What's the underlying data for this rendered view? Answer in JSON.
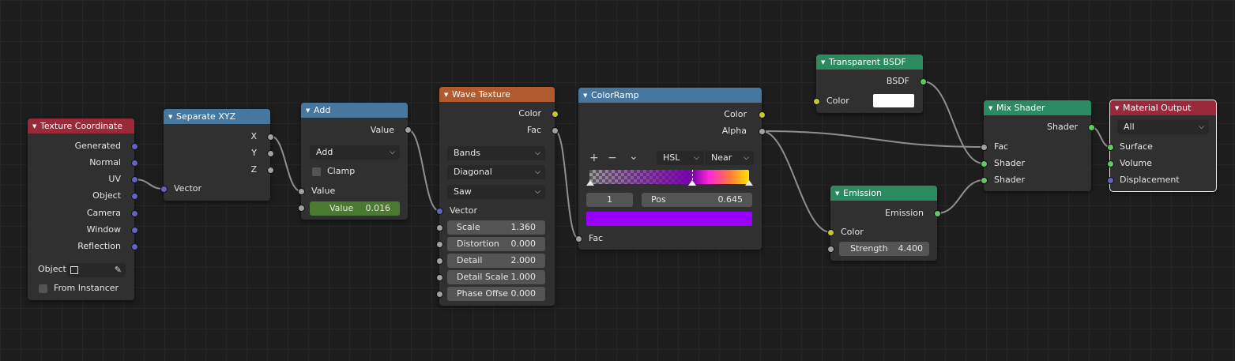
{
  "colors": {
    "input_header": "#9a2a3a",
    "converter_header": "#4577a1",
    "texture_header": "#b05a2f",
    "shader_header": "#2c8a60",
    "ramp_bar_color": "#9a00ff",
    "transparent_color": "#ffffff"
  },
  "texture_coordinate": {
    "title": "Texture Coordinate",
    "outputs": [
      "Generated",
      "Normal",
      "UV",
      "Object",
      "Camera",
      "Window",
      "Reflection"
    ],
    "object_label": "Object:",
    "from_instancer_label": "From Instancer",
    "eyedropper_icon": "eyedropper-icon"
  },
  "separate_xyz": {
    "title": "Separate XYZ",
    "outputs": [
      "X",
      "Y",
      "Z"
    ],
    "input": "Vector"
  },
  "add_node": {
    "title": "Add",
    "output": "Value",
    "operation": "Add",
    "clamp_label": "Clamp",
    "input_label": "Value",
    "value_field_label": "Value",
    "value_field_value": "0.016"
  },
  "wave_texture": {
    "title": "Wave Texture",
    "outputs": [
      "Color",
      "Fac"
    ],
    "type": "Bands",
    "direction": "Diagonal",
    "profile": "Saw",
    "vector_label": "Vector",
    "fields": [
      {
        "label": "Scale",
        "value": "1.360"
      },
      {
        "label": "Distortion",
        "value": "0.000"
      },
      {
        "label": "Detail",
        "value": "2.000"
      },
      {
        "label": "Detail Scale",
        "value": "1.000"
      },
      {
        "label": "Phase Offse",
        "value": "0.000"
      }
    ]
  },
  "color_ramp": {
    "title": "ColorRamp",
    "outputs": [
      "Color",
      "Alpha"
    ],
    "add_icon": "+",
    "remove_icon": "−",
    "menu_icon": "⌄",
    "color_mode": "HSL",
    "interpolation": "Near",
    "active_index": "1",
    "pos_label": "Pos",
    "pos_value": "0.645",
    "stop_position": 0.645,
    "input": "Fac"
  },
  "transparent_bsdf": {
    "title": "Transparent BSDF",
    "output": "BSDF",
    "color_label": "Color"
  },
  "emission": {
    "title": "Emission",
    "output": "Emission",
    "color_label": "Color",
    "strength_label": "Strength",
    "strength_value": "4.400"
  },
  "mix_shader": {
    "title": "Mix Shader",
    "output": "Shader",
    "inputs": [
      "Fac",
      "Shader",
      "Shader"
    ]
  },
  "material_output": {
    "title": "Material Output",
    "target": "All",
    "inputs": [
      "Surface",
      "Volume",
      "Displacement"
    ]
  }
}
